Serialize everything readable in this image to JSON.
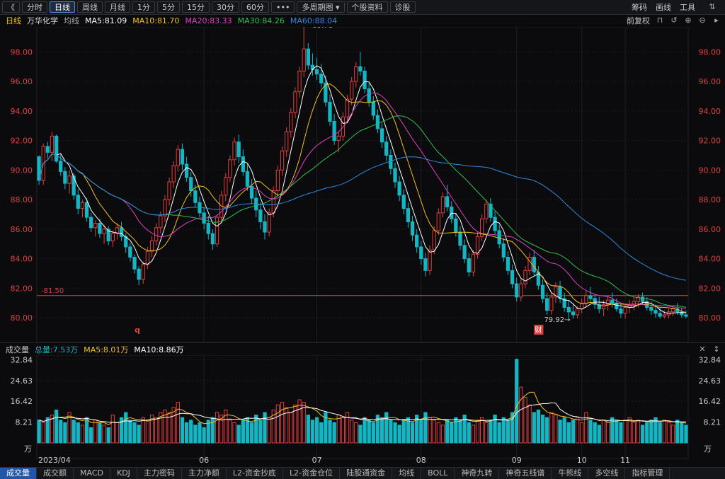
{
  "toolbar": {
    "back": "《",
    "tabs": [
      "分时",
      "日线",
      "周线",
      "月线",
      "1分",
      "5分",
      "15分",
      "30分",
      "60分",
      "•••",
      "多周期图",
      "个股资料",
      "诊股"
    ],
    "active": "日线",
    "dropdown_icon": "chevron-down-icon",
    "right": [
      "筹码",
      "画线",
      "工具"
    ]
  },
  "ma_line": {
    "period": "日线",
    "stock": "万华化学",
    "style": "均线",
    "ma5": "MA5:81.09",
    "ma10": "MA10:81.70",
    "ma20": "MA20:83.33",
    "ma30": "MA30:84.26",
    "ma60": "MA60:88.04",
    "adjust": "前复权"
  },
  "volume_line": {
    "title": "成交量",
    "total": "总量:7.53万",
    "ma5": "MA5:8.01万",
    "ma10": "MA10:8.86万"
  },
  "colors": {
    "up": "#e04040",
    "down": "#14b6c4",
    "ma5": "#ffffff",
    "ma10": "#f0c020",
    "ma20": "#e040c0",
    "ma30": "#30c050",
    "ma60": "#2a8ae0",
    "axis": "#e04040",
    "support": "#e04040"
  },
  "chart_data": {
    "type": "candlestick",
    "y_ticks": [
      80,
      82,
      84,
      86,
      88,
      90,
      92,
      94,
      96,
      98
    ],
    "ylim": [
      79.0,
      99.5
    ],
    "x_labels": [
      "2023/04",
      "06",
      "07",
      "08",
      "09",
      "10",
      "11"
    ],
    "support_level": "81.50",
    "high_label": "99.78",
    "low_label": "79.92",
    "markers": [
      "q",
      "财"
    ],
    "candle_count": 150,
    "volume_ticks": [
      "32.84",
      "24.63",
      "16.42",
      "8.21"
    ],
    "volume_unit": "万",
    "volume_ylim": [
      0,
      33.5
    ],
    "ohlc": [
      [
        90.9,
        91.0,
        89.0,
        89.3
      ],
      [
        89.3,
        91.8,
        89.0,
        91.6
      ],
      [
        91.6,
        91.9,
        90.8,
        91.2
      ],
      [
        91.2,
        92.6,
        90.6,
        92.3
      ],
      [
        92.3,
        92.4,
        90.5,
        90.6
      ],
      [
        90.6,
        91.1,
        89.6,
        89.9
      ],
      [
        89.9,
        90.2,
        88.7,
        89.1
      ],
      [
        89.1,
        90.0,
        88.4,
        89.6
      ],
      [
        89.6,
        89.8,
        88.0,
        88.3
      ],
      [
        88.3,
        88.7,
        87.0,
        87.4
      ],
      [
        87.4,
        88.0,
        86.8,
        87.8
      ],
      [
        87.8,
        88.1,
        86.5,
        86.8
      ],
      [
        86.8,
        87.1,
        85.8,
        86.1
      ],
      [
        86.1,
        86.6,
        85.5,
        86.4
      ],
      [
        86.4,
        86.7,
        85.4,
        85.7
      ],
      [
        85.7,
        86.3,
        85.0,
        86.0
      ],
      [
        86.0,
        86.2,
        84.9,
        85.2
      ],
      [
        85.2,
        85.9,
        84.8,
        85.7
      ],
      [
        85.7,
        86.4,
        85.3,
        86.1
      ],
      [
        86.1,
        86.5,
        85.2,
        85.5
      ],
      [
        85.5,
        85.7,
        84.4,
        84.8
      ],
      [
        84.8,
        85.1,
        83.8,
        84.1
      ],
      [
        84.1,
        84.3,
        83.0,
        83.3
      ],
      [
        83.3,
        83.5,
        82.2,
        82.6
      ],
      [
        82.6,
        83.8,
        82.3,
        83.6
      ],
      [
        83.6,
        84.8,
        83.3,
        84.5
      ],
      [
        84.5,
        85.5,
        84.1,
        85.2
      ],
      [
        85.2,
        86.4,
        84.9,
        86.1
      ],
      [
        86.1,
        87.2,
        85.7,
        86.9
      ],
      [
        86.9,
        88.3,
        86.5,
        88.0
      ],
      [
        88.0,
        89.5,
        87.6,
        89.2
      ],
      [
        89.2,
        90.6,
        88.8,
        90.3
      ],
      [
        90.3,
        91.7,
        89.9,
        91.4
      ],
      [
        91.4,
        91.8,
        90.0,
        90.4
      ],
      [
        90.4,
        90.9,
        89.2,
        89.5
      ],
      [
        89.5,
        89.9,
        88.2,
        88.6
      ],
      [
        88.6,
        89.0,
        87.5,
        87.8
      ],
      [
        87.8,
        88.2,
        86.8,
        87.1
      ],
      [
        87.1,
        87.5,
        86.0,
        86.4
      ],
      [
        86.4,
        86.9,
        85.3,
        85.7
      ],
      [
        85.7,
        86.0,
        84.6,
        85.0
      ],
      [
        85.0,
        87.0,
        84.8,
        86.8
      ],
      [
        86.8,
        88.6,
        86.4,
        88.3
      ],
      [
        88.3,
        89.8,
        87.9,
        89.5
      ],
      [
        89.5,
        91.0,
        89.2,
        90.7
      ],
      [
        90.7,
        92.2,
        90.3,
        91.9
      ],
      [
        91.9,
        92.4,
        90.5,
        90.9
      ],
      [
        90.9,
        91.4,
        89.6,
        89.9
      ],
      [
        89.9,
        90.4,
        88.6,
        88.9
      ],
      [
        88.9,
        89.4,
        87.7,
        88.1
      ],
      [
        88.1,
        88.6,
        86.8,
        87.3
      ],
      [
        87.3,
        87.8,
        86.0,
        86.5
      ],
      [
        86.5,
        87.0,
        85.3,
        85.8
      ],
      [
        85.8,
        87.4,
        85.5,
        87.1
      ],
      [
        87.1,
        88.9,
        86.8,
        88.6
      ],
      [
        88.6,
        90.3,
        88.2,
        90.0
      ],
      [
        90.0,
        91.6,
        89.6,
        91.3
      ],
      [
        91.3,
        92.9,
        90.9,
        92.6
      ],
      [
        92.6,
        94.2,
        92.2,
        93.9
      ],
      [
        93.9,
        95.6,
        93.5,
        95.3
      ],
      [
        95.3,
        97.0,
        94.9,
        96.7
      ],
      [
        96.7,
        99.78,
        96.3,
        98.2
      ],
      [
        98.2,
        98.6,
        96.8,
        97.1
      ],
      [
        97.1,
        97.9,
        96.4,
        96.8
      ],
      [
        96.8,
        97.6,
        96.1,
        96.5
      ],
      [
        96.5,
        97.2,
        95.6,
        95.9
      ],
      [
        95.9,
        96.4,
        94.3,
        94.6
      ],
      [
        94.6,
        95.1,
        93.0,
        93.3
      ],
      [
        93.3,
        93.8,
        91.7,
        92.0
      ],
      [
        92.0,
        92.6,
        91.2,
        92.3
      ],
      [
        92.3,
        93.9,
        92.0,
        93.6
      ],
      [
        93.6,
        95.1,
        93.2,
        94.8
      ],
      [
        94.8,
        96.3,
        94.4,
        96.0
      ],
      [
        96.0,
        97.3,
        95.6,
        97.0
      ],
      [
        97.0,
        98.0,
        96.4,
        96.7
      ],
      [
        96.7,
        97.0,
        95.2,
        95.5
      ],
      [
        95.5,
        95.9,
        94.3,
        94.6
      ],
      [
        94.6,
        95.0,
        93.4,
        93.7
      ],
      [
        93.7,
        94.1,
        92.5,
        92.8
      ],
      [
        92.8,
        93.2,
        91.5,
        91.9
      ],
      [
        91.9,
        92.3,
        90.6,
        91.0
      ],
      [
        91.0,
        91.4,
        89.7,
        90.1
      ],
      [
        90.1,
        90.5,
        88.8,
        89.2
      ],
      [
        89.2,
        89.6,
        87.9,
        88.3
      ],
      [
        88.3,
        88.7,
        87.0,
        87.4
      ],
      [
        87.4,
        87.8,
        86.1,
        86.5
      ],
      [
        86.5,
        86.9,
        85.2,
        85.6
      ],
      [
        85.6,
        86.0,
        84.4,
        84.8
      ],
      [
        84.8,
        85.2,
        83.6,
        84.0
      ],
      [
        84.0,
        84.4,
        82.8,
        83.2
      ],
      [
        83.2,
        84.9,
        82.9,
        84.6
      ],
      [
        84.6,
        86.2,
        84.3,
        85.9
      ],
      [
        85.9,
        87.4,
        85.6,
        87.1
      ],
      [
        87.1,
        88.5,
        86.8,
        88.2
      ],
      [
        88.2,
        89.0,
        87.2,
        87.5
      ],
      [
        87.5,
        87.9,
        86.4,
        86.7
      ],
      [
        86.7,
        87.1,
        85.5,
        85.8
      ],
      [
        85.8,
        86.2,
        84.6,
        84.9
      ],
      [
        84.9,
        85.3,
        83.7,
        84.0
      ],
      [
        84.0,
        84.4,
        82.8,
        83.1
      ],
      [
        83.1,
        84.6,
        82.8,
        84.3
      ],
      [
        84.3,
        85.8,
        84.0,
        85.5
      ],
      [
        85.5,
        87.0,
        85.2,
        86.7
      ],
      [
        86.7,
        88.0,
        86.4,
        87.7
      ],
      [
        87.7,
        88.1,
        86.5,
        86.8
      ],
      [
        86.8,
        87.2,
        85.6,
        85.9
      ],
      [
        85.9,
        86.3,
        84.7,
        85.0
      ],
      [
        85.0,
        85.4,
        83.8,
        84.1
      ],
      [
        84.1,
        84.5,
        82.9,
        83.2
      ],
      [
        83.2,
        83.6,
        82.0,
        82.3
      ],
      [
        82.3,
        82.7,
        81.1,
        81.4
      ],
      [
        81.4,
        82.6,
        81.1,
        82.3
      ],
      [
        82.3,
        83.5,
        82.0,
        83.2
      ],
      [
        83.2,
        84.4,
        82.9,
        84.1
      ],
      [
        84.1,
        84.6,
        82.8,
        83.1
      ],
      [
        83.1,
        83.5,
        81.9,
        82.2
      ],
      [
        82.2,
        82.6,
        81.0,
        81.3
      ],
      [
        81.3,
        81.7,
        80.2,
        80.5
      ],
      [
        80.5,
        81.7,
        80.2,
        81.4
      ],
      [
        81.4,
        82.4,
        81.0,
        82.1
      ],
      [
        82.1,
        82.5,
        81.0,
        81.3
      ],
      [
        81.3,
        81.7,
        80.4,
        80.7
      ],
      [
        80.7,
        81.2,
        80.0,
        80.4
      ],
      [
        80.4,
        80.9,
        79.92,
        80.2
      ],
      [
        80.2,
        80.8,
        79.95,
        80.6
      ],
      [
        80.6,
        81.3,
        80.3,
        81.0
      ],
      [
        81.0,
        81.8,
        80.7,
        81.5
      ],
      [
        81.5,
        82.1,
        81.0,
        81.3
      ],
      [
        81.3,
        81.6,
        80.6,
        80.9
      ],
      [
        80.9,
        81.4,
        80.3,
        80.6
      ],
      [
        80.6,
        81.2,
        80.1,
        80.9
      ],
      [
        80.9,
        81.5,
        80.5,
        81.2
      ],
      [
        81.2,
        81.7,
        80.7,
        81.0
      ],
      [
        81.0,
        81.3,
        80.4,
        80.6
      ],
      [
        80.6,
        81.0,
        80.0,
        80.3
      ],
      [
        80.3,
        80.9,
        79.95,
        80.7
      ],
      [
        80.7,
        81.2,
        80.3,
        80.9
      ],
      [
        80.9,
        81.4,
        80.5,
        81.1
      ],
      [
        81.1,
        81.6,
        80.7,
        81.4
      ],
      [
        81.4,
        81.7,
        80.9,
        81.1
      ],
      [
        81.1,
        81.4,
        80.5,
        80.7
      ],
      [
        80.7,
        81.1,
        80.2,
        80.5
      ],
      [
        80.5,
        80.9,
        80.0,
        80.3
      ],
      [
        80.3,
        80.7,
        79.95,
        80.1
      ],
      [
        80.1,
        80.5,
        79.95,
        80.2
      ],
      [
        80.2,
        80.6,
        79.95,
        80.4
      ],
      [
        80.4,
        80.8,
        80.1,
        80.6
      ],
      [
        80.6,
        81.0,
        80.2,
        80.4
      ],
      [
        80.4,
        80.7,
        80.0,
        80.2
      ],
      [
        80.2,
        80.5,
        79.95,
        80.1
      ]
    ],
    "volume": [
      9,
      8,
      10,
      11,
      13,
      9,
      8,
      12,
      9,
      8,
      7,
      10,
      6,
      9,
      8,
      7,
      6,
      11,
      8,
      10,
      12,
      9,
      8,
      7,
      10,
      9,
      11,
      10,
      12,
      13,
      12,
      14,
      16,
      10,
      8,
      9,
      7,
      8,
      6,
      9,
      10,
      12,
      11,
      13,
      9,
      8,
      7,
      9,
      10,
      8,
      11,
      9,
      12,
      10,
      13,
      15,
      16,
      14,
      12,
      15,
      17,
      16,
      11,
      9,
      10,
      8,
      12,
      9,
      8,
      11,
      10,
      12,
      9,
      8,
      7,
      10,
      9,
      8,
      11,
      10,
      12,
      9,
      8,
      7,
      9,
      10,
      8,
      11,
      9,
      12,
      10,
      9,
      8,
      7,
      9,
      8,
      10,
      9,
      11,
      8,
      7,
      9,
      10,
      8,
      9,
      11,
      8,
      10,
      9,
      12,
      33,
      22,
      18,
      15,
      12,
      13,
      11,
      10,
      12,
      11,
      9,
      10,
      8,
      9,
      10,
      8,
      12,
      9,
      8,
      7,
      9,
      8,
      10,
      9,
      8,
      9,
      10,
      8,
      9,
      7,
      8,
      9,
      10,
      8,
      9,
      8,
      7,
      9,
      8,
      7
    ]
  },
  "tabs": {
    "items": [
      "成交量",
      "成交额",
      "MACD",
      "KDJ",
      "主力密码",
      "主力净额",
      "L2-资金抄底",
      "L2-资金仓位",
      "陆股通资金",
      "均线",
      "BOLL",
      "神奇九转",
      "神奇五线谱",
      "牛熊线",
      "多空线",
      "指标管理"
    ],
    "active": "成交量"
  }
}
